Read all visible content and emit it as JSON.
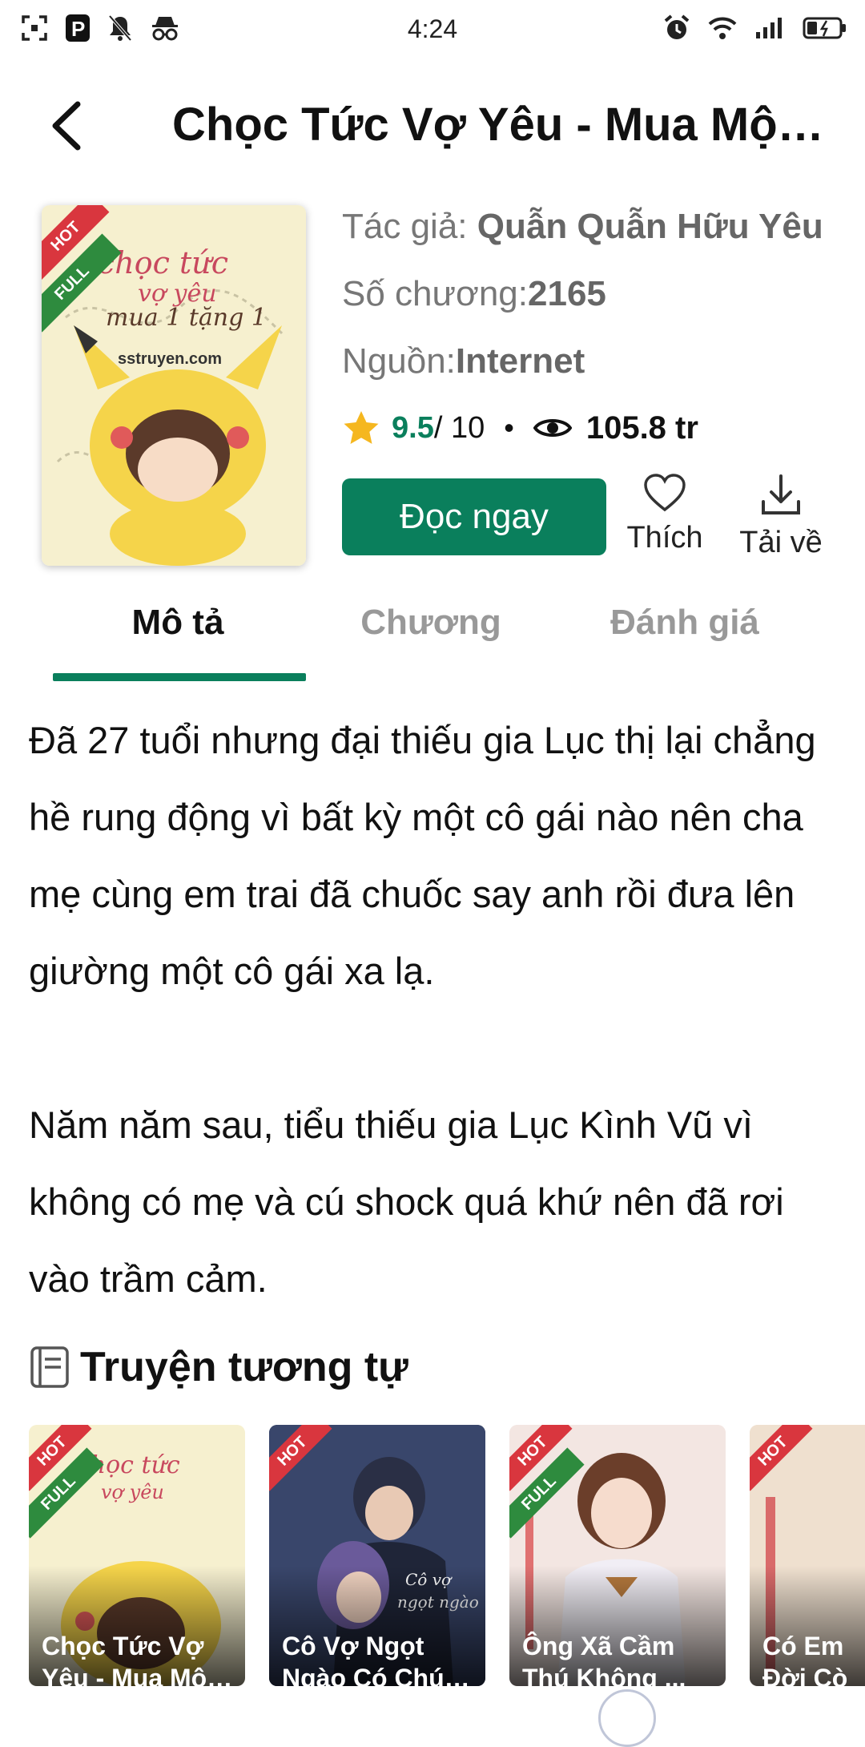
{
  "status_bar": {
    "time": "4:24"
  },
  "header": {
    "title": "Chọc Tức Vợ Yêu - Mua Một ..."
  },
  "cover": {
    "watermark": "sstruyen.com",
    "badges": [
      "HOT",
      "FULL"
    ]
  },
  "info": {
    "author_label": "Tác giả: ",
    "author": "Quẫn Quẫn Hữu Yêu",
    "chapters_label": "Số chương:",
    "chapters": "2165",
    "source_label": "Nguồn:",
    "source": "Internet",
    "rating": "9.5",
    "rating_max": " / 10",
    "views": "105.8 tr"
  },
  "actions": {
    "read": "Đọc ngay",
    "like": "Thích",
    "download": "Tải về"
  },
  "tabs": [
    {
      "label": "Mô tả",
      "active": true
    },
    {
      "label": "Chương",
      "active": false
    },
    {
      "label": "Đánh giá",
      "active": false
    }
  ],
  "description": [
    "Đã 27 tuổi nhưng đại thiếu gia Lục thị lại chẳng hề rung động vì bất kỳ một cô gái nào nên cha mẹ cùng em trai đã chuốc say anh rồi đưa lên giường một cô gái xa lạ.",
    "Năm năm sau, tiểu thiếu gia Lục Kình Vũ vì không có mẹ và cú shock quá khứ nên đã rơi vào trầm cảm."
  ],
  "similar": {
    "title": "Truyện tương tự",
    "items": [
      {
        "line1": "Chọc Tức Vợ",
        "line2": "Yêu - Mua Một...",
        "badges": [
          "HOT",
          "FULL"
        ]
      },
      {
        "line1": "Cô Vợ Ngọt",
        "line2": "Ngào Có Chút ...",
        "badges": [
          "HOT"
        ]
      },
      {
        "line1": "Ông Xã Cầm",
        "line2": "Thú Không ...",
        "badges": [
          "HOT",
          "FULL"
        ]
      },
      {
        "line1": "Có Em",
        "line2": "Đời Cò",
        "badges": [
          "HOT"
        ]
      }
    ]
  },
  "colors": {
    "accent": "#0a7f5c",
    "hot": "#d9363e",
    "full": "#2e8b3e"
  }
}
